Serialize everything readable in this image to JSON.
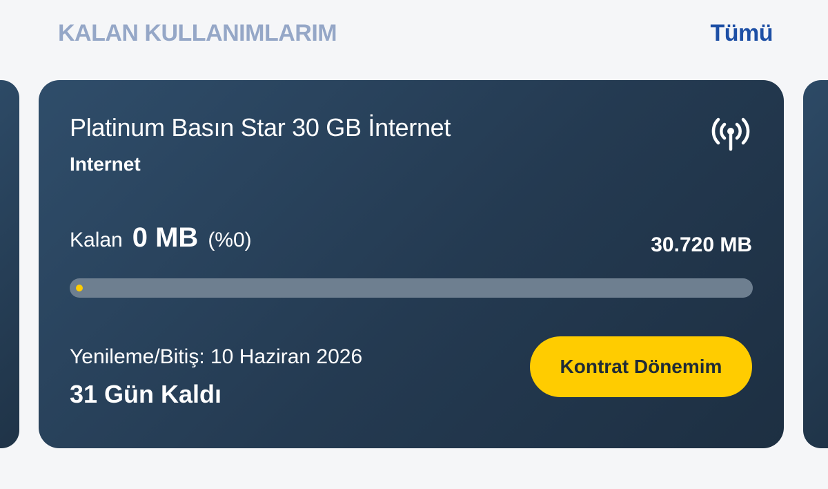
{
  "header": {
    "title": "KALAN KULLANIMLARIM",
    "see_all_label": "Tümü"
  },
  "card": {
    "plan_name": "Platinum Basın Star 30 GB İnternet",
    "plan_type": "Internet",
    "icon": "antenna-signal-icon",
    "remaining_label": "Kalan",
    "remaining_amount": "0 MB",
    "remaining_percent_text": "(%0)",
    "total_amount": "30.720 MB",
    "usage_remaining_fraction": 0,
    "renewal_text": "Yenileme/Bitiş: 10 Haziran 2026",
    "days_left": "31 Gün Kaldı",
    "contract_button_label": "Kontrat Dönemim"
  },
  "colors": {
    "background": "#f5f6f8",
    "card_dark": "#243a51",
    "accent_yellow": "#ffcc00",
    "title_muted": "#95a7c7",
    "link_blue": "#1d4fa5",
    "progress_track": "#6e7f90"
  }
}
